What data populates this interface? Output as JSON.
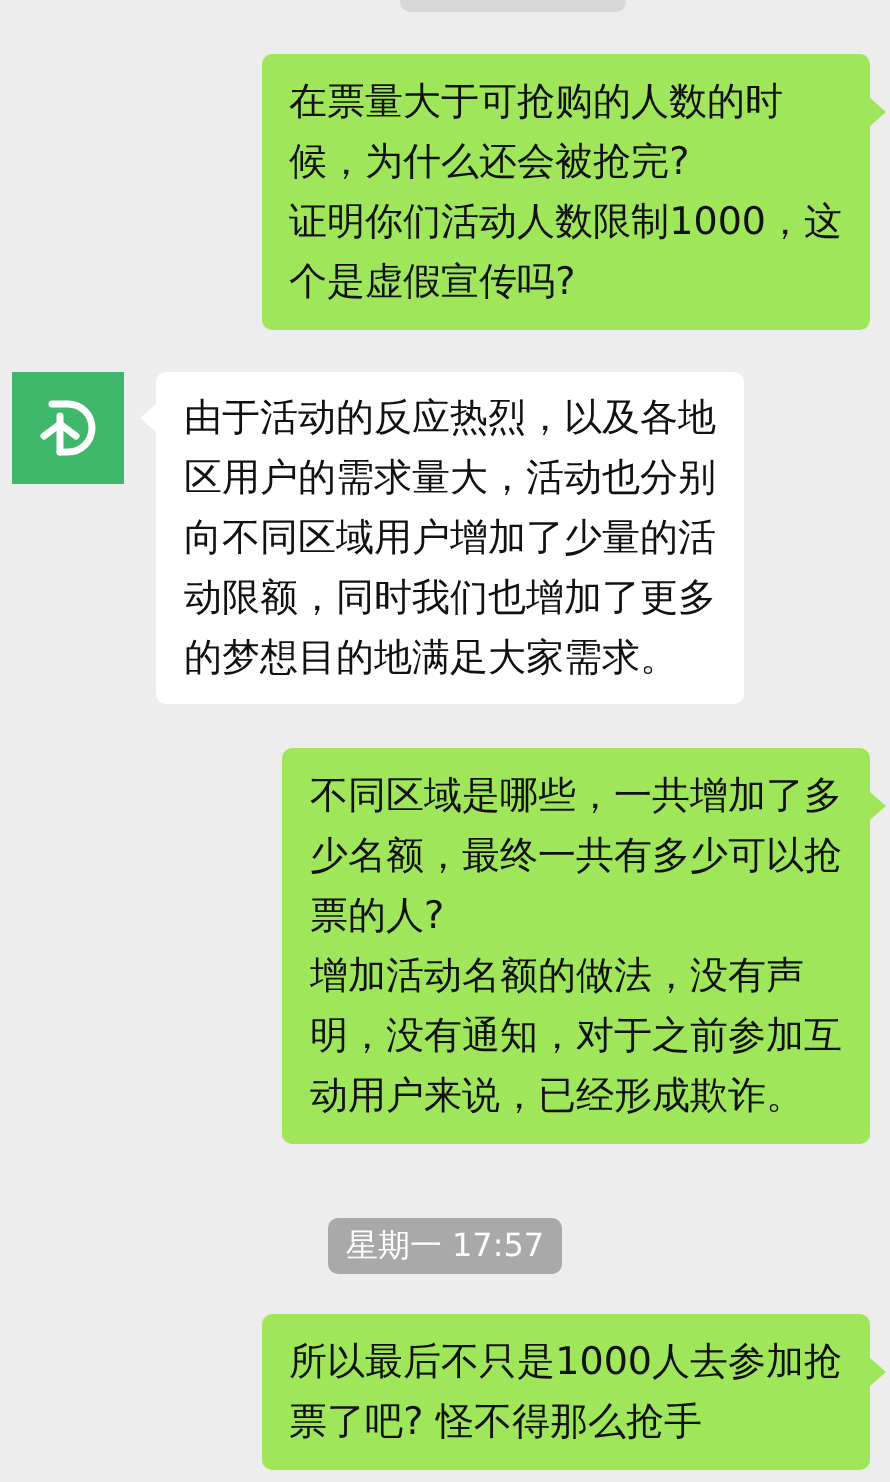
{
  "messages": [
    {
      "kind": "sent",
      "lines": [
        "在票量大于可抢购的人数的时",
        "候，为什么还会被抢完?",
        "证明你们活动人数限制1000，这",
        "个是虚假宣传吗?"
      ]
    },
    {
      "kind": "received",
      "lines": [
        "由于活动的反应热烈，以及各地",
        "区用户的需求量大，活动也分别",
        "向不同区域用户增加了少量的活",
        "动限额，同时我们也增加了更多",
        "的梦想目的地满足大家需求。"
      ]
    },
    {
      "kind": "sent",
      "lines": [
        "不同区域是哪些，一共增加了多",
        "少名额，最终一共有多少可以抢",
        "票的人?",
        "增加活动名额的做法，没有声",
        "明，没有通知，对于之前参加互",
        "动用户来说，已经形成欺诈。"
      ]
    },
    {
      "kind": "time",
      "text": "星期一 17:57"
    },
    {
      "kind": "sent",
      "lines": [
        "所以最后不只是1000人去参加抢",
        "票了吧? 怪不得那么抢手"
      ]
    }
  ]
}
